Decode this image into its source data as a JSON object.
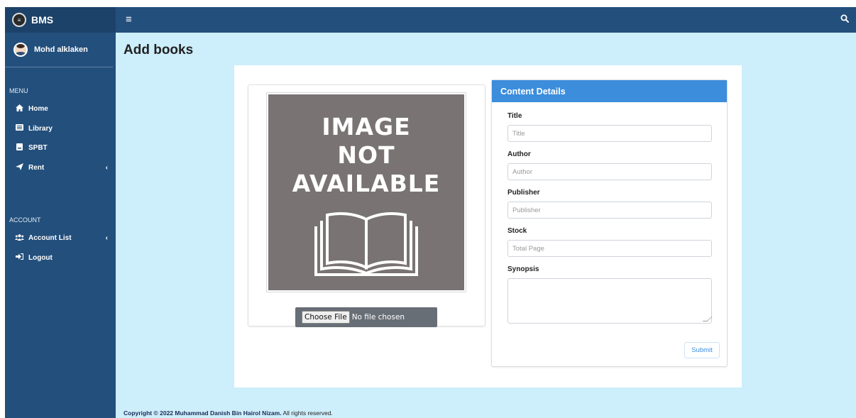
{
  "brand": {
    "name": "BMS",
    "logo_icon": "bms-logo-icon"
  },
  "user": {
    "name": "Mohd alklaken"
  },
  "sidebar": {
    "menu_header": "MENU",
    "menu_items": [
      {
        "label": "Home",
        "icon": "home-icon",
        "glyph": "🏠"
      },
      {
        "label": "Library",
        "icon": "library-icon",
        "glyph": "▤"
      },
      {
        "label": "SPBT",
        "icon": "spbt-icon",
        "glyph": "▬"
      },
      {
        "label": "Rent",
        "icon": "rent-icon",
        "glyph": "➤",
        "has_submenu": true
      }
    ],
    "account_header": "ACCOUNT",
    "account_items": [
      {
        "label": "Account List",
        "icon": "users-icon",
        "glyph": "👥",
        "has_submenu": true
      },
      {
        "label": "Logout",
        "icon": "logout-icon",
        "glyph": "⇥"
      }
    ]
  },
  "topbar": {
    "menu_toggle_icon": "hamburger-icon",
    "search_icon": "search-icon"
  },
  "page": {
    "title": "Add books"
  },
  "image_preview": {
    "placeholder_lines": [
      "IMAGE",
      "NOT",
      "AVAILABLE"
    ],
    "choose_file_label": "Choose File",
    "no_file_text": "No file chosen"
  },
  "form": {
    "header": "Content Details",
    "fields": {
      "title": {
        "label": "Title",
        "placeholder": "Title",
        "value": ""
      },
      "author": {
        "label": "Author",
        "placeholder": "Author",
        "value": ""
      },
      "publisher": {
        "label": "Publisher",
        "placeholder": "Publisher",
        "value": ""
      },
      "stock": {
        "label": "Stock",
        "placeholder": "Total Page",
        "value": ""
      },
      "synopsis": {
        "label": "Synopsis",
        "value": ""
      }
    },
    "submit_label": "Submit"
  },
  "footer": {
    "prefix": "Copyright © 2022 Muhammad Danish Bin Hairol Nizam.",
    "suffix": " All rights reserved."
  },
  "colors": {
    "sidebar": "#234f7c",
    "brand_bar": "#1d4269",
    "content_bg": "#cdeefb",
    "form_header": "#3c8ddc",
    "image_placeholder": "#797373"
  }
}
